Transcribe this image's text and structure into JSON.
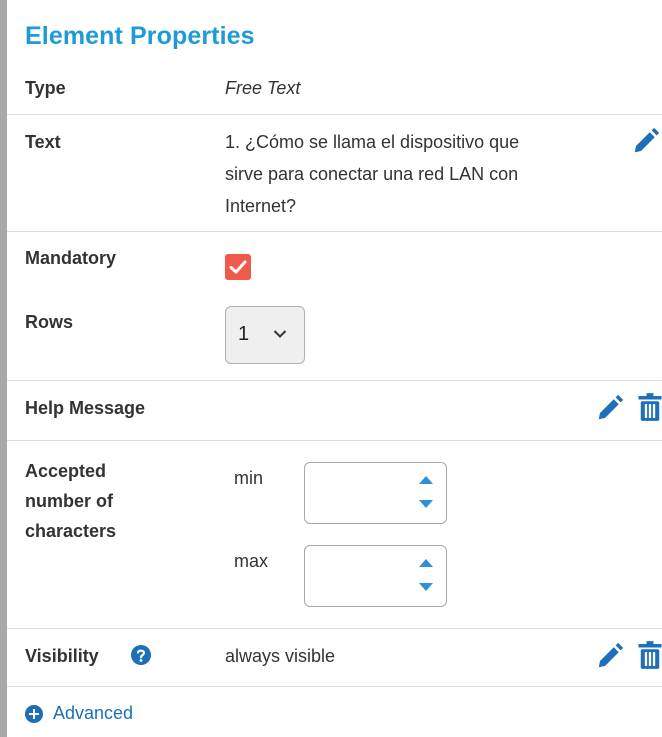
{
  "panel": {
    "title": "Element Properties",
    "type": {
      "label": "Type",
      "value": "Free Text"
    },
    "text": {
      "label": "Text",
      "lines": [
        "1. ¿Cómo se llama el dispositivo que",
        "sirve para conectar una red LAN con",
        "Internet?"
      ]
    },
    "mandatory": {
      "label": "Mandatory",
      "checked": true
    },
    "rows": {
      "label": "Rows",
      "value": "1"
    },
    "help_message": {
      "label": "Help Message"
    },
    "accepted_chars": {
      "label_lines": [
        "Accepted",
        "number of",
        "characters"
      ],
      "min_label": "min",
      "max_label": "max",
      "min_value": "",
      "max_value": ""
    },
    "visibility": {
      "label": "Visibility",
      "value": "always visible"
    },
    "advanced_label": "Advanced"
  },
  "colors": {
    "accent": "#1e9bd7",
    "icon_blue": "#1c6fb8",
    "checkbox_red": "#f05a4a",
    "separator": "#dddddd"
  },
  "icons": [
    "pencil-icon",
    "trash-icon",
    "help-icon",
    "plus-circle-icon",
    "chevron-down-icon",
    "spinner-up-icon",
    "spinner-down-icon",
    "checkmark-icon"
  ]
}
